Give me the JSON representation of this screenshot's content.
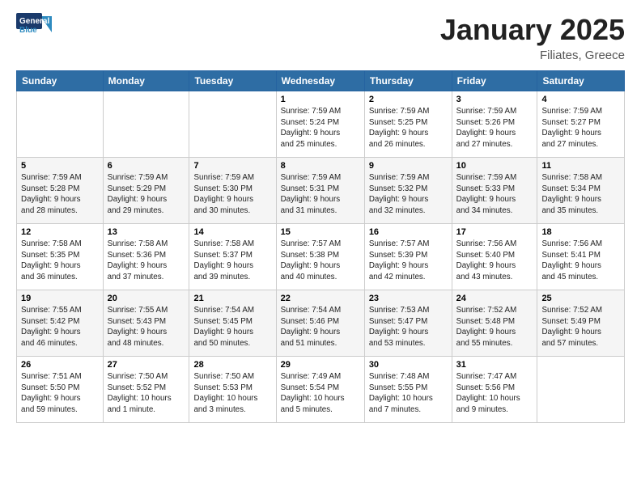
{
  "header": {
    "logo_general": "General",
    "logo_blue": "Blue",
    "month_year": "January 2025",
    "location": "Filiates, Greece"
  },
  "weekdays": [
    "Sunday",
    "Monday",
    "Tuesday",
    "Wednesday",
    "Thursday",
    "Friday",
    "Saturday"
  ],
  "weeks": [
    [
      {
        "day": "",
        "info": ""
      },
      {
        "day": "",
        "info": ""
      },
      {
        "day": "",
        "info": ""
      },
      {
        "day": "1",
        "info": "Sunrise: 7:59 AM\nSunset: 5:24 PM\nDaylight: 9 hours\nand 25 minutes."
      },
      {
        "day": "2",
        "info": "Sunrise: 7:59 AM\nSunset: 5:25 PM\nDaylight: 9 hours\nand 26 minutes."
      },
      {
        "day": "3",
        "info": "Sunrise: 7:59 AM\nSunset: 5:26 PM\nDaylight: 9 hours\nand 27 minutes."
      },
      {
        "day": "4",
        "info": "Sunrise: 7:59 AM\nSunset: 5:27 PM\nDaylight: 9 hours\nand 27 minutes."
      }
    ],
    [
      {
        "day": "5",
        "info": "Sunrise: 7:59 AM\nSunset: 5:28 PM\nDaylight: 9 hours\nand 28 minutes."
      },
      {
        "day": "6",
        "info": "Sunrise: 7:59 AM\nSunset: 5:29 PM\nDaylight: 9 hours\nand 29 minutes."
      },
      {
        "day": "7",
        "info": "Sunrise: 7:59 AM\nSunset: 5:30 PM\nDaylight: 9 hours\nand 30 minutes."
      },
      {
        "day": "8",
        "info": "Sunrise: 7:59 AM\nSunset: 5:31 PM\nDaylight: 9 hours\nand 31 minutes."
      },
      {
        "day": "9",
        "info": "Sunrise: 7:59 AM\nSunset: 5:32 PM\nDaylight: 9 hours\nand 32 minutes."
      },
      {
        "day": "10",
        "info": "Sunrise: 7:59 AM\nSunset: 5:33 PM\nDaylight: 9 hours\nand 34 minutes."
      },
      {
        "day": "11",
        "info": "Sunrise: 7:58 AM\nSunset: 5:34 PM\nDaylight: 9 hours\nand 35 minutes."
      }
    ],
    [
      {
        "day": "12",
        "info": "Sunrise: 7:58 AM\nSunset: 5:35 PM\nDaylight: 9 hours\nand 36 minutes."
      },
      {
        "day": "13",
        "info": "Sunrise: 7:58 AM\nSunset: 5:36 PM\nDaylight: 9 hours\nand 37 minutes."
      },
      {
        "day": "14",
        "info": "Sunrise: 7:58 AM\nSunset: 5:37 PM\nDaylight: 9 hours\nand 39 minutes."
      },
      {
        "day": "15",
        "info": "Sunrise: 7:57 AM\nSunset: 5:38 PM\nDaylight: 9 hours\nand 40 minutes."
      },
      {
        "day": "16",
        "info": "Sunrise: 7:57 AM\nSunset: 5:39 PM\nDaylight: 9 hours\nand 42 minutes."
      },
      {
        "day": "17",
        "info": "Sunrise: 7:56 AM\nSunset: 5:40 PM\nDaylight: 9 hours\nand 43 minutes."
      },
      {
        "day": "18",
        "info": "Sunrise: 7:56 AM\nSunset: 5:41 PM\nDaylight: 9 hours\nand 45 minutes."
      }
    ],
    [
      {
        "day": "19",
        "info": "Sunrise: 7:55 AM\nSunset: 5:42 PM\nDaylight: 9 hours\nand 46 minutes."
      },
      {
        "day": "20",
        "info": "Sunrise: 7:55 AM\nSunset: 5:43 PM\nDaylight: 9 hours\nand 48 minutes."
      },
      {
        "day": "21",
        "info": "Sunrise: 7:54 AM\nSunset: 5:45 PM\nDaylight: 9 hours\nand 50 minutes."
      },
      {
        "day": "22",
        "info": "Sunrise: 7:54 AM\nSunset: 5:46 PM\nDaylight: 9 hours\nand 51 minutes."
      },
      {
        "day": "23",
        "info": "Sunrise: 7:53 AM\nSunset: 5:47 PM\nDaylight: 9 hours\nand 53 minutes."
      },
      {
        "day": "24",
        "info": "Sunrise: 7:52 AM\nSunset: 5:48 PM\nDaylight: 9 hours\nand 55 minutes."
      },
      {
        "day": "25",
        "info": "Sunrise: 7:52 AM\nSunset: 5:49 PM\nDaylight: 9 hours\nand 57 minutes."
      }
    ],
    [
      {
        "day": "26",
        "info": "Sunrise: 7:51 AM\nSunset: 5:50 PM\nDaylight: 9 hours\nand 59 minutes."
      },
      {
        "day": "27",
        "info": "Sunrise: 7:50 AM\nSunset: 5:52 PM\nDaylight: 10 hours\nand 1 minute."
      },
      {
        "day": "28",
        "info": "Sunrise: 7:50 AM\nSunset: 5:53 PM\nDaylight: 10 hours\nand 3 minutes."
      },
      {
        "day": "29",
        "info": "Sunrise: 7:49 AM\nSunset: 5:54 PM\nDaylight: 10 hours\nand 5 minutes."
      },
      {
        "day": "30",
        "info": "Sunrise: 7:48 AM\nSunset: 5:55 PM\nDaylight: 10 hours\nand 7 minutes."
      },
      {
        "day": "31",
        "info": "Sunrise: 7:47 AM\nSunset: 5:56 PM\nDaylight: 10 hours\nand 9 minutes."
      },
      {
        "day": "",
        "info": ""
      }
    ]
  ]
}
